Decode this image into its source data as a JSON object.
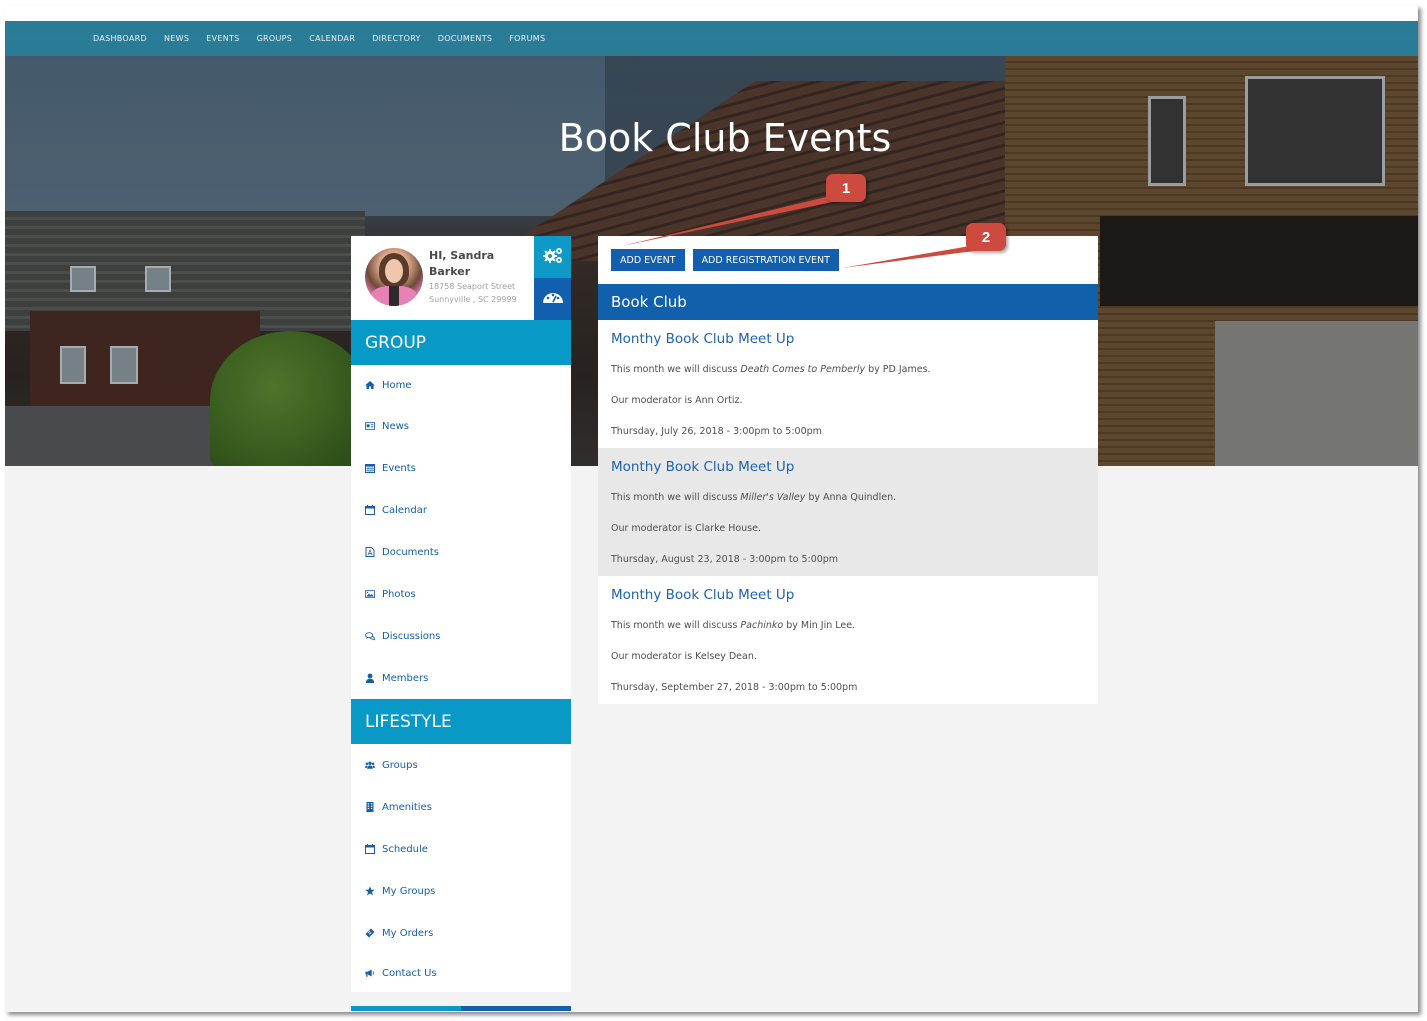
{
  "nav": {
    "items": [
      "DASHBOARD",
      "NEWS",
      "EVENTS",
      "GROUPS",
      "CALENDAR",
      "DIRECTORY",
      "DOCUMENTS",
      "FORUMS"
    ]
  },
  "hero": {
    "title": "Book Club Events"
  },
  "profile": {
    "greeting_line1": "HI, Sandra",
    "greeting_line2": "Barker",
    "address_line1": "18758 Seaport Street",
    "address_line2": "Sunnyville , SC 29999",
    "settings_icon": "gears-icon",
    "dashboard_icon": "dashboard-gauge-icon"
  },
  "sidebar": {
    "group": {
      "heading": "GROUP",
      "items": [
        {
          "label": "Home",
          "icon": "home-icon"
        },
        {
          "label": "News",
          "icon": "newspaper-icon"
        },
        {
          "label": "Events",
          "icon": "calendar-grid-icon"
        },
        {
          "label": "Calendar",
          "icon": "calendar-icon"
        },
        {
          "label": "Documents",
          "icon": "pdf-document-icon"
        },
        {
          "label": "Photos",
          "icon": "image-icon"
        },
        {
          "label": "Discussions",
          "icon": "chat-bubbles-icon"
        },
        {
          "label": "Members",
          "icon": "user-icon"
        }
      ]
    },
    "lifestyle": {
      "heading": "LIFESTYLE",
      "items": [
        {
          "label": "Groups",
          "icon": "users-icon"
        },
        {
          "label": "Amenities",
          "icon": "building-icon"
        },
        {
          "label": "Schedule",
          "icon": "calendar-icon"
        },
        {
          "label": "My Groups",
          "icon": "star-icon"
        },
        {
          "label": "My Orders",
          "icon": "ticket-icon"
        },
        {
          "label": "Contact Us",
          "icon": "bullhorn-icon"
        }
      ]
    }
  },
  "main": {
    "add_event_label": "ADD EVENT",
    "add_registration_event_label": "ADD REGISTRATION EVENT",
    "panel_title": "Book Club",
    "events": [
      {
        "title": "Monthy Book Club Meet Up",
        "discuss_prefix": "This month we will discuss ",
        "book": "Death Comes to Pemberly",
        "discuss_suffix": " by PD James.",
        "moderator": "Our moderator is Ann Ortiz.",
        "datetime": "Thursday, July 26, 2018 - 3:00pm to 5:00pm"
      },
      {
        "title": "Monthy Book Club Meet Up",
        "discuss_prefix": "This month we will discuss ",
        "book": "Miller's Valley",
        "discuss_suffix": " by Anna Quindlen.",
        "moderator": "Our moderator is Clarke House.",
        "datetime": "Thursday, August 23, 2018 - 3:00pm to 5:00pm"
      },
      {
        "title": "Monthy Book Club Meet Up",
        "discuss_prefix": "This month we will discuss ",
        "book": "Pachinko",
        "discuss_suffix": " by Min Jin Lee.",
        "moderator": "Our moderator is Kelsey Dean.",
        "datetime": "Thursday, September 27, 2018 - 3:00pm to 5:00pm"
      }
    ]
  },
  "annotations": [
    {
      "number": "1",
      "target": "add-event-button"
    },
    {
      "number": "2",
      "target": "add-registration-event-button"
    }
  ],
  "colors": {
    "nav_bar": "#2887a5",
    "section_heading": "#0899c6",
    "primary_blue": "#115fae",
    "link_blue": "#1f62ad",
    "callout_red": "#cc4a3e",
    "alt_row": "#e8e8e8"
  }
}
